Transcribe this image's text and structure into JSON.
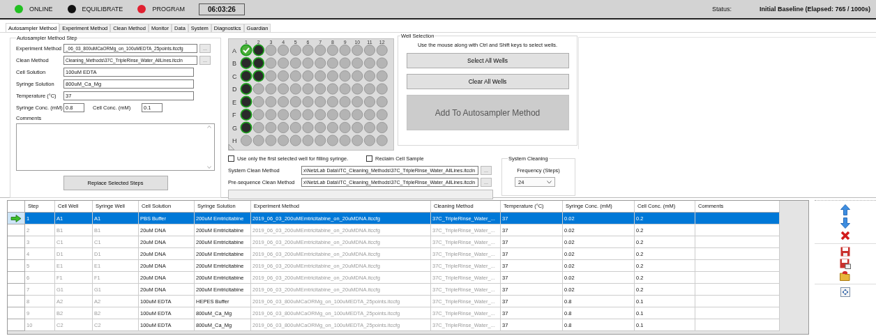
{
  "status_bar": {
    "indicators": [
      {
        "label": "ONLINE",
        "color": "#22c022"
      },
      {
        "label": "EQUILIBRATE",
        "color": "#111111"
      },
      {
        "label": "PROGRAM",
        "color": "#e02030"
      }
    ],
    "clock": "06:03:26",
    "status_label": "Status:",
    "status_value": "Initial Baseline (Elapsed: 765 / 1000s)"
  },
  "tabs": [
    {
      "label": "Autosampler Method",
      "selected": true
    },
    {
      "label": "Experiment Method",
      "selected": false
    },
    {
      "label": "Clean Method",
      "selected": false
    },
    {
      "label": "Monitor",
      "selected": false
    },
    {
      "label": "Data",
      "selected": false
    },
    {
      "label": "System",
      "selected": false
    },
    {
      "label": "Diagnostics",
      "selected": false
    },
    {
      "label": "Guardian",
      "selected": false
    }
  ],
  "method_step": {
    "title": "Autosampler Method Step",
    "fields": [
      {
        "label": "Experiment Method",
        "value": "_06_03_800uMCaORMg_on_100uMEDTA_25points.itccfg",
        "kind": "browse"
      },
      {
        "label": "Clean Method",
        "value": "Cleaning_Methods\\37C_TripleRinse_Water_AllLines.itccln",
        "kind": "browse"
      },
      {
        "label": "Cell Solution",
        "value": "100uM EDTA",
        "kind": "text"
      },
      {
        "label": "Syringe Solution",
        "value": "800uM_Ca_Mg",
        "kind": "text"
      },
      {
        "label": "Temperature (°C)",
        "value": "37",
        "kind": "text"
      }
    ],
    "syringe_conc": {
      "label": "Syringe Conc. (mM)",
      "value": "0.8"
    },
    "cell_conc": {
      "label": "Cell Conc. (mM)",
      "value": "0.1"
    },
    "comments_label": "Comments",
    "replace_button": "Replace Selected Steps",
    "browse_button": "..."
  },
  "plate": {
    "columns": [
      "1",
      "2",
      "3",
      "4",
      "5",
      "6",
      "7",
      "8",
      "9",
      "10",
      "11",
      "12"
    ],
    "rows": [
      {
        "label": "A",
        "wells": [
          {
            "selected": true,
            "checked": true
          },
          {
            "selected": true,
            "checked": false
          },
          {
            "selected": false,
            "checked": false
          },
          {
            "selected": false,
            "checked": false
          },
          {
            "selected": false,
            "checked": false
          },
          {
            "selected": false,
            "checked": false
          },
          {
            "selected": false,
            "checked": false
          },
          {
            "selected": false,
            "checked": false
          },
          {
            "selected": false,
            "checked": false
          },
          {
            "selected": false,
            "checked": false
          },
          {
            "selected": false,
            "checked": false
          },
          {
            "selected": false,
            "checked": false
          }
        ]
      },
      {
        "label": "B",
        "wells": [
          {
            "selected": true,
            "checked": false
          },
          {
            "selected": true,
            "checked": false
          },
          {
            "selected": false,
            "checked": false
          },
          {
            "selected": false,
            "checked": false
          },
          {
            "selected": false,
            "checked": false
          },
          {
            "selected": false,
            "checked": false
          },
          {
            "selected": false,
            "checked": false
          },
          {
            "selected": false,
            "checked": false
          },
          {
            "selected": false,
            "checked": false
          },
          {
            "selected": false,
            "checked": false
          },
          {
            "selected": false,
            "checked": false
          },
          {
            "selected": false,
            "checked": false
          }
        ]
      },
      {
        "label": "C",
        "wells": [
          {
            "selected": true,
            "checked": false
          },
          {
            "selected": true,
            "checked": false
          },
          {
            "selected": false,
            "checked": false
          },
          {
            "selected": false,
            "checked": false
          },
          {
            "selected": false,
            "checked": false
          },
          {
            "selected": false,
            "checked": false
          },
          {
            "selected": false,
            "checked": false
          },
          {
            "selected": false,
            "checked": false
          },
          {
            "selected": false,
            "checked": false
          },
          {
            "selected": false,
            "checked": false
          },
          {
            "selected": false,
            "checked": false
          },
          {
            "selected": false,
            "checked": false
          }
        ]
      },
      {
        "label": "D",
        "wells": [
          {
            "selected": true,
            "checked": false
          },
          {
            "selected": false,
            "checked": false
          },
          {
            "selected": false,
            "checked": false
          },
          {
            "selected": false,
            "checked": false
          },
          {
            "selected": false,
            "checked": false
          },
          {
            "selected": false,
            "checked": false
          },
          {
            "selected": false,
            "checked": false
          },
          {
            "selected": false,
            "checked": false
          },
          {
            "selected": false,
            "checked": false
          },
          {
            "selected": false,
            "checked": false
          },
          {
            "selected": false,
            "checked": false
          },
          {
            "selected": false,
            "checked": false
          }
        ]
      },
      {
        "label": "E",
        "wells": [
          {
            "selected": true,
            "checked": false
          },
          {
            "selected": false,
            "checked": false
          },
          {
            "selected": false,
            "checked": false
          },
          {
            "selected": false,
            "checked": false
          },
          {
            "selected": false,
            "checked": false
          },
          {
            "selected": false,
            "checked": false
          },
          {
            "selected": false,
            "checked": false
          },
          {
            "selected": false,
            "checked": false
          },
          {
            "selected": false,
            "checked": false
          },
          {
            "selected": false,
            "checked": false
          },
          {
            "selected": false,
            "checked": false
          },
          {
            "selected": false,
            "checked": false
          }
        ]
      },
      {
        "label": "F",
        "wells": [
          {
            "selected": true,
            "checked": false
          },
          {
            "selected": false,
            "checked": false
          },
          {
            "selected": false,
            "checked": false
          },
          {
            "selected": false,
            "checked": false
          },
          {
            "selected": false,
            "checked": false
          },
          {
            "selected": false,
            "checked": false
          },
          {
            "selected": false,
            "checked": false
          },
          {
            "selected": false,
            "checked": false
          },
          {
            "selected": false,
            "checked": false
          },
          {
            "selected": false,
            "checked": false
          },
          {
            "selected": false,
            "checked": false
          },
          {
            "selected": false,
            "checked": false
          }
        ]
      },
      {
        "label": "G",
        "wells": [
          {
            "selected": true,
            "checked": false
          },
          {
            "selected": false,
            "checked": false
          },
          {
            "selected": false,
            "checked": false
          },
          {
            "selected": false,
            "checked": false
          },
          {
            "selected": false,
            "checked": false
          },
          {
            "selected": false,
            "checked": false
          },
          {
            "selected": false,
            "checked": false
          },
          {
            "selected": false,
            "checked": false
          },
          {
            "selected": false,
            "checked": false
          },
          {
            "selected": false,
            "checked": false
          },
          {
            "selected": false,
            "checked": false
          },
          {
            "selected": false,
            "checked": false
          }
        ]
      },
      {
        "label": "H",
        "wells": [
          {
            "selected": false,
            "checked": false
          },
          {
            "selected": false,
            "checked": false
          },
          {
            "selected": false,
            "checked": false
          },
          {
            "selected": false,
            "checked": false
          },
          {
            "selected": false,
            "checked": false
          },
          {
            "selected": false,
            "checked": false
          },
          {
            "selected": false,
            "checked": false
          },
          {
            "selected": false,
            "checked": false
          },
          {
            "selected": false,
            "checked": false
          },
          {
            "selected": false,
            "checked": false
          },
          {
            "selected": false,
            "checked": false
          },
          {
            "selected": false,
            "checked": false
          }
        ]
      }
    ]
  },
  "well_selection": {
    "title": "Well Selection",
    "hint": "Use the mouse along with Ctrl and Shift keys to select wells.",
    "buttons": [
      "Select All Wells",
      "Clear All Wells"
    ],
    "add_button": "Add To Autosampler Method"
  },
  "options": [
    {
      "label": "Use only the first selected well for filling syringe.",
      "checked": false
    },
    {
      "label": "Reclaim Cell Sample",
      "checked": false
    }
  ],
  "clean_methods": [
    {
      "label": "System Clean Method",
      "value": "x\\NetzLab Data\\ITC_Cleaning_Methods\\37C_TripleRinse_Water_AllLines.itccln"
    },
    {
      "label": "Pre-sequence Clean Method",
      "value": "x\\NetzLab Data\\ITC_Cleaning_Methods\\37C_TripleRinse_Water_AllLines.itccln"
    }
  ],
  "progress": {
    "level": 0
  },
  "system_cleaning": {
    "title": "System Cleaning",
    "frequency_label": "Frequency (Steps)",
    "frequency_value": "24"
  },
  "table": {
    "columns": [
      {
        "label": "Step",
        "dimmed": true
      },
      {
        "label": "Cell Well",
        "dimmed": true
      },
      {
        "label": "Syringe Well",
        "dimmed": true
      },
      {
        "label": "Cell Solution",
        "dimmed": false
      },
      {
        "label": "Syringe Solution",
        "dimmed": false
      },
      {
        "label": "Experiment Method",
        "dimmed": true
      },
      {
        "label": "Cleaning Method",
        "dimmed": true
      },
      {
        "label": "Temperature (°C)",
        "dimmed": false
      },
      {
        "label": "Syringe Conc. (mM)",
        "dimmed": false
      },
      {
        "label": "Cell Conc. (mM)",
        "dimmed": false
      },
      {
        "label": "Comments"
      }
    ],
    "rows": [
      {
        "selected": true,
        "current": true,
        "cells": [
          "1",
          "A1",
          "A1",
          "PBS Buffer",
          "200uM Emtricitabine",
          "2019_06_03_200uMEmtricitabine_on_20uMDNA.itccfg",
          "37C_TripleRinse_Water_...",
          "37",
          "0.02",
          "0.2"
        ]
      },
      {
        "selected": false,
        "current": false,
        "cells": [
          "2",
          "B1",
          "B1",
          "20uM DNA",
          "200uM Emtricitabine",
          "2019_06_03_200uMEmtricitabine_on_20uMDNA.itccfg",
          "37C_TripleRinse_Water_...",
          "37",
          "0.02",
          "0.2"
        ]
      },
      {
        "selected": false,
        "current": false,
        "cells": [
          "3",
          "C1",
          "C1",
          "20uM DNA",
          "200uM Emtricitabine",
          "2019_06_03_200uMEmtricitabine_on_20uMDNA.itccfg",
          "37C_TripleRinse_Water_...",
          "37",
          "0.02",
          "0.2"
        ]
      },
      {
        "selected": false,
        "current": false,
        "cells": [
          "4",
          "D1",
          "D1",
          "20uM DNA",
          "200uM Emtricitabine",
          "2019_06_03_200uMEmtricitabine_on_20uMDNA.itccfg",
          "37C_TripleRinse_Water_...",
          "37",
          "0.02",
          "0.2"
        ]
      },
      {
        "selected": false,
        "current": false,
        "cells": [
          "5",
          "E1",
          "E1",
          "20uM DNA",
          "200uM Emtricitabine",
          "2019_06_03_200uMEmtricitabine_on_20uMDNA.itccfg",
          "37C_TripleRinse_Water_...",
          "37",
          "0.02",
          "0.2"
        ]
      },
      {
        "selected": false,
        "current": false,
        "cells": [
          "6",
          "F1",
          "F1",
          "20uM DNA",
          "200uM Emtricitabine",
          "2019_06_03_200uMEmtricitabine_on_20uMDNA.itccfg",
          "37C_TripleRinse_Water_...",
          "37",
          "0.02",
          "0.2"
        ]
      },
      {
        "selected": false,
        "current": false,
        "cells": [
          "7",
          "G1",
          "G1",
          "20uM DNA",
          "200uM Emtricitabine",
          "2019_06_03_200uMEmtricitabine_on_20uMDNA.itccfg",
          "37C_TripleRinse_Water_...",
          "37",
          "0.02",
          "0.2"
        ]
      },
      {
        "selected": false,
        "current": false,
        "cells": [
          "8",
          "A2",
          "A2",
          "100uM EDTA",
          "HEPES Buffer",
          "2019_06_03_800uMCaORMg_on_100uMEDTA_25points.itccfg",
          "37C_TripleRinse_Water_...",
          "37",
          "0.8",
          "0.1"
        ]
      },
      {
        "selected": false,
        "current": false,
        "cells": [
          "9",
          "B2",
          "B2",
          "100uM EDTA",
          "800uM_Ca_Mg",
          "2019_06_03_800uMCaORMg_on_100uMEDTA_25points.itccfg",
          "37C_TripleRinse_Water_...",
          "37",
          "0.8",
          "0.1"
        ]
      },
      {
        "selected": false,
        "current": false,
        "cells": [
          "10",
          "C2",
          "C2",
          "100uM EDTA",
          "800uM_Ca_Mg",
          "2019_06_03_800uMCaORMg_on_100uMEDTA_25points.itccfg",
          "37C_TripleRinse_Water_...",
          "37",
          "0.8",
          "0.1"
        ]
      }
    ]
  }
}
